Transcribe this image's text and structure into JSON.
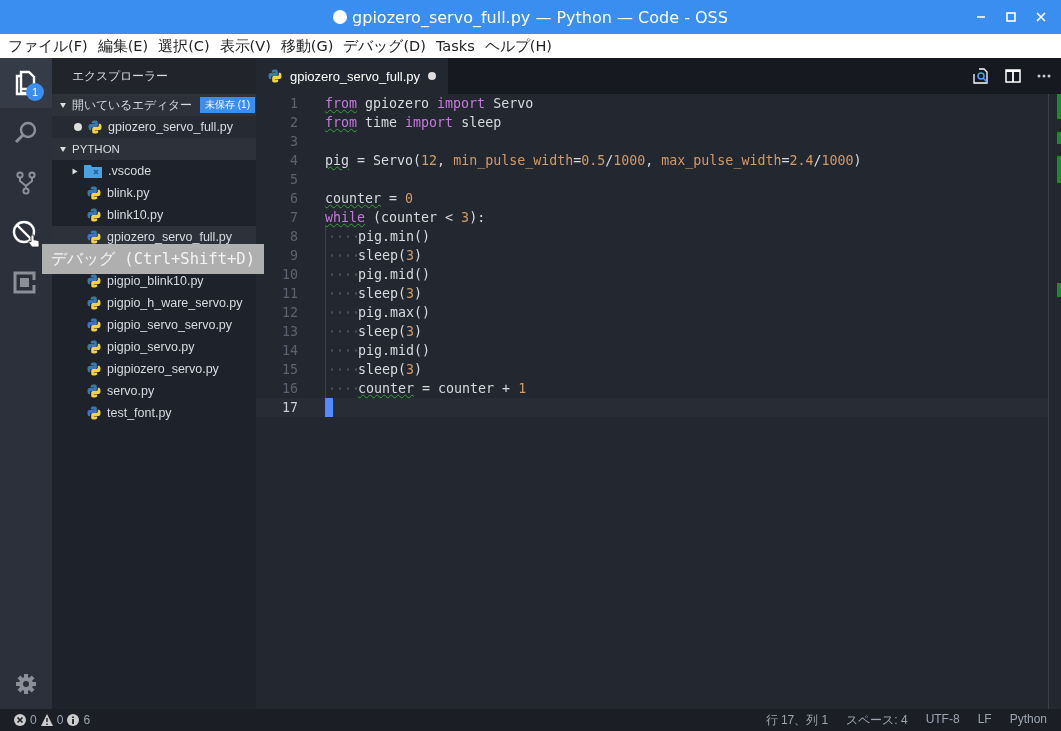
{
  "window": {
    "title": "gpiozero_servo_full.py — Python — Code - OSS",
    "dirty": true
  },
  "menu": [
    "ファイル(F)",
    "編集(E)",
    "選択(C)",
    "表示(V)",
    "移動(G)",
    "デバッグ(D)",
    "Tasks",
    "ヘルプ(H)"
  ],
  "activity_bar": [
    {
      "kind": "files",
      "selected": true,
      "hovered": false,
      "badge": "1"
    },
    {
      "kind": "search",
      "selected": false,
      "hovered": false
    },
    {
      "kind": "source-control",
      "selected": false,
      "hovered": false
    },
    {
      "kind": "debug",
      "selected": false,
      "hovered": true
    },
    {
      "kind": "extensions",
      "selected": false,
      "hovered": false
    }
  ],
  "tooltip": "デバッグ (Ctrl+Shift+D)",
  "sidebar": {
    "title": "エクスプローラー",
    "open_editors": {
      "title": "開いているエディター",
      "expanded": true,
      "badge": "未保存 (1)",
      "items": [
        {
          "name": "gpiozero_servo_full.py",
          "dirty": true
        }
      ]
    },
    "folder": {
      "title": "PYTHON",
      "expanded": true,
      "items": [
        {
          "name": ".vscode",
          "kind": "folder",
          "hovered": false
        },
        {
          "name": "blink.py",
          "kind": "python",
          "hovered": false
        },
        {
          "name": "blink10.py",
          "kind": "python",
          "hovered": false
        },
        {
          "name": "gpiozero_servo_full.py",
          "kind": "python",
          "hovered": true
        },
        {
          "name": "pigpio_blink10.py",
          "kind": "python",
          "hovered": false
        },
        {
          "name": "pigpio_h_ware_servo.py",
          "kind": "python",
          "hovered": false
        },
        {
          "name": "pigpio_servo_servo.py",
          "kind": "python",
          "hovered": false
        },
        {
          "name": "pigpio_servo.py",
          "kind": "python",
          "hovered": false
        },
        {
          "name": "pigpiozero_servo.py",
          "kind": "python",
          "hovered": false
        },
        {
          "name": "servo.py",
          "kind": "python",
          "hovered": false
        },
        {
          "name": "test_font.py",
          "kind": "python",
          "hovered": false
        }
      ]
    }
  },
  "tabs": [
    {
      "label": "gpiozero_servo_full.py",
      "selected": true,
      "dirty": true
    }
  ],
  "editor": {
    "lines": [
      {
        "number": "1",
        "indented": false,
        "current": false,
        "tokens": [
          {
            "text": "from",
            "kind": "keyword",
            "squiggle": true
          },
          {
            "text": " gpiozero ",
            "kind": "plain",
            "squiggle": false
          },
          {
            "text": "import",
            "kind": "keyword",
            "squiggle": false
          },
          {
            "text": " Servo",
            "kind": "plain",
            "squiggle": false
          }
        ]
      },
      {
        "number": "2",
        "indented": false,
        "current": false,
        "tokens": [
          {
            "text": "from",
            "kind": "keyword",
            "squiggle": true
          },
          {
            "text": " time ",
            "kind": "plain",
            "squiggle": false
          },
          {
            "text": "import",
            "kind": "keyword",
            "squiggle": false
          },
          {
            "text": " sleep",
            "kind": "plain",
            "squiggle": false
          }
        ]
      },
      {
        "number": "3",
        "indented": false,
        "current": false
      },
      {
        "number": "4",
        "indented": false,
        "current": false,
        "tokens": [
          {
            "text": "pig",
            "kind": "plain",
            "squiggle": true
          },
          {
            "text": " = Servo(",
            "kind": "plain",
            "squiggle": false
          },
          {
            "text": "12",
            "kind": "number",
            "squiggle": false
          },
          {
            "text": ", ",
            "kind": "plain",
            "squiggle": false
          },
          {
            "text": "min_pulse_width",
            "kind": "param",
            "squiggle": false
          },
          {
            "text": "=",
            "kind": "plain",
            "squiggle": false
          },
          {
            "text": "0.5",
            "kind": "number",
            "squiggle": false
          },
          {
            "text": "/",
            "kind": "plain",
            "squiggle": false
          },
          {
            "text": "1000",
            "kind": "number",
            "squiggle": false
          },
          {
            "text": ", ",
            "kind": "plain",
            "squiggle": false
          },
          {
            "text": "max_pulse_width",
            "kind": "param",
            "squiggle": false
          },
          {
            "text": "=",
            "kind": "plain",
            "squiggle": false
          },
          {
            "text": "2.4",
            "kind": "number",
            "squiggle": false
          },
          {
            "text": "/",
            "kind": "plain",
            "squiggle": false
          },
          {
            "text": "1000",
            "kind": "number",
            "squiggle": false
          },
          {
            "text": ")",
            "kind": "plain",
            "squiggle": false
          }
        ]
      },
      {
        "number": "5",
        "indented": false,
        "current": false
      },
      {
        "number": "6",
        "indented": false,
        "current": false,
        "tokens": [
          {
            "text": "counter",
            "kind": "plain",
            "squiggle": true
          },
          {
            "text": " = ",
            "kind": "plain",
            "squiggle": false
          },
          {
            "text": "0",
            "kind": "number",
            "squiggle": false
          }
        ]
      },
      {
        "number": "7",
        "indented": false,
        "current": false,
        "tokens": [
          {
            "text": "while",
            "kind": "keyword",
            "squiggle": true
          },
          {
            "text": " (counter < ",
            "kind": "plain",
            "squiggle": false
          },
          {
            "text": "3",
            "kind": "number",
            "squiggle": false
          },
          {
            "text": "):",
            "kind": "plain",
            "squiggle": false
          }
        ]
      },
      {
        "number": "8",
        "indented": true,
        "current": false,
        "tokens": [
          {
            "text": "pig.min()",
            "kind": "plain",
            "squiggle": false
          }
        ]
      },
      {
        "number": "9",
        "indented": true,
        "current": false,
        "tokens": [
          {
            "text": "sleep(",
            "kind": "plain",
            "squiggle": false
          },
          {
            "text": "3",
            "kind": "number",
            "squiggle": false
          },
          {
            "text": ")",
            "kind": "plain",
            "squiggle": false
          }
        ]
      },
      {
        "number": "10",
        "indented": true,
        "current": false,
        "tokens": [
          {
            "text": "pig.mid()",
            "kind": "plain",
            "squiggle": false
          }
        ]
      },
      {
        "number": "11",
        "indented": true,
        "current": false,
        "tokens": [
          {
            "text": "sleep(",
            "kind": "plain",
            "squiggle": false
          },
          {
            "text": "3",
            "kind": "number",
            "squiggle": false
          },
          {
            "text": ")",
            "kind": "plain",
            "squiggle": false
          }
        ]
      },
      {
        "number": "12",
        "indented": true,
        "current": false,
        "tokens": [
          {
            "text": "pig.max()",
            "kind": "plain",
            "squiggle": false
          }
        ]
      },
      {
        "number": "13",
        "indented": true,
        "current": false,
        "tokens": [
          {
            "text": "sleep(",
            "kind": "plain",
            "squiggle": false
          },
          {
            "text": "3",
            "kind": "number",
            "squiggle": false
          },
          {
            "text": ")",
            "kind": "plain",
            "squiggle": false
          }
        ]
      },
      {
        "number": "14",
        "indented": true,
        "current": false,
        "tokens": [
          {
            "text": "pig.mid()",
            "kind": "plain",
            "squiggle": false
          }
        ]
      },
      {
        "number": "15",
        "indented": true,
        "current": false,
        "tokens": [
          {
            "text": "sleep(",
            "kind": "plain",
            "squiggle": false
          },
          {
            "text": "3",
            "kind": "number",
            "squiggle": false
          },
          {
            "text": ")",
            "kind": "plain",
            "squiggle": false
          }
        ]
      },
      {
        "number": "16",
        "indented": true,
        "current": false,
        "tokens": [
          {
            "text": "counter",
            "kind": "plain",
            "squiggle": true
          },
          {
            "text": " = counter + ",
            "kind": "plain",
            "squiggle": false
          },
          {
            "text": "1",
            "kind": "number",
            "squiggle": false
          }
        ]
      },
      {
        "number": "17",
        "indented": false,
        "current": true
      }
    ]
  },
  "status_bar": {
    "errors": "0",
    "warnings": "0",
    "infos": "6",
    "right": [
      "行 17、列 1",
      "スペース: 4",
      "UTF-8",
      "LF",
      "Python"
    ]
  }
}
